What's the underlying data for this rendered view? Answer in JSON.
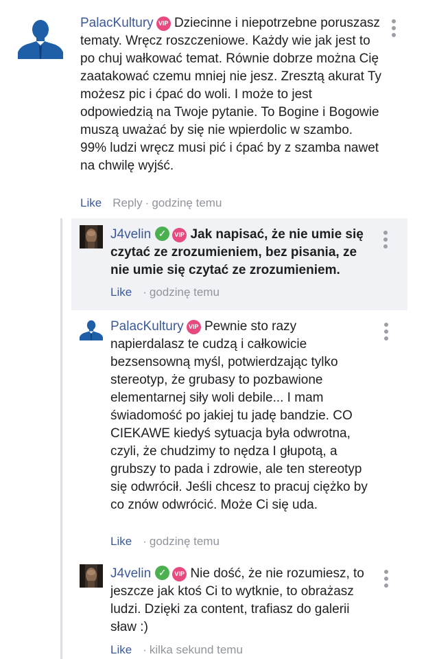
{
  "colors": {
    "author_link": "#3b5998",
    "meta_text": "#90949c",
    "vip_badge": "#e84a7f",
    "verified_badge": "#4caf50",
    "highlight_background": "#f0f2f5"
  },
  "icons": {
    "vip_badge": "VIP",
    "verified_badge": "checkmark",
    "more_menu": "vertical-ellipsis",
    "avatar_default": "person-silhouette",
    "avatar_photo": "profile-photo"
  },
  "comments": [
    {
      "author": "PalacKultury",
      "text": "Dziecinne i niepotrzebne poruszasz tematy. Wręcz roszczeniowe. Każdy wie jak jest to po chuj wałkować temat. Równie dobrze można Cię zaatakować czemu mniej nie jesz. Zresztą akurat Ty możesz pic i ćpać do woli. I może to jest odpowiedzią na Twoje pytanie. To Bogine i Bogowie muszą uważać by się nie wpierdolic w szambo. 99% ludzi wręcz musi pić i ćpać by z szamba nawet na chwilę wyjść.",
      "like": "Like",
      "reply": "Reply",
      "separator": "·",
      "time": "godzinę temu"
    },
    {
      "author": "J4velin",
      "text": "Jak napisać, że nie umie się czytać ze zrozumieniem, bez pisania, ze nie umie się czytać ze zrozumieniem.",
      "like": "Like",
      "separator": "·",
      "time": "godzinę temu"
    },
    {
      "author": "PalacKultury",
      "text": "Pewnie sto razy napierdalasz te cudzą i całkowicie bezsensowną myśl, potwierdzając tylko stereotyp, że grubasy to pozbawione elementarnej siły woli debile... I mam świadomość po jakiej tu jadę bandzie. CO CIEKAWE kiedyś sytuacja była odwrotna, czyli, że chudzimy to nędza I głupotą, a grubszy to pada i zdrowie, ale ten stereotyp się odwrócił. Jeśli chcesz to pracuj ciężko by co znów odwrócić. Może Ci się uda.",
      "like": "Like",
      "separator": "·",
      "time": "godzinę temu"
    },
    {
      "author": "J4velin",
      "text": "Nie dość, że nie rozumiesz, to jeszcze jak ktoś Ci to wytknie, to obrażasz ludzi. Dzięki za content, trafiasz do galerii sław :)",
      "like": "Like",
      "separator": "·",
      "time": "kilka sekund temu"
    }
  ]
}
